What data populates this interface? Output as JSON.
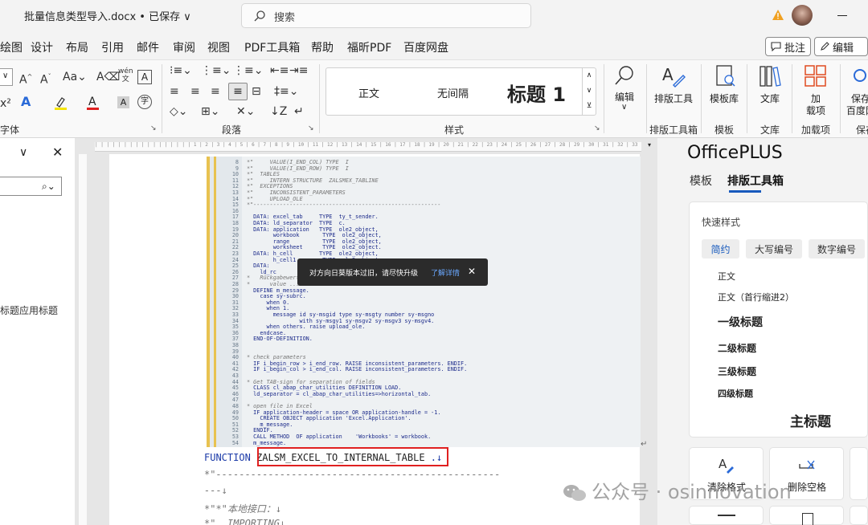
{
  "titlebar": {
    "doc_title": "批量信息类型导入.docx • 已保存 ∨",
    "search_placeholder": "搜索"
  },
  "menu": {
    "items": [
      "绘图",
      "设计",
      "布局",
      "引用",
      "邮件",
      "审阅",
      "视图",
      "PDF工具箱",
      "帮助",
      "福昕PDF",
      "百度网盘"
    ],
    "comment_btn": "批注",
    "edit_btn": "编辑"
  },
  "ribbon": {
    "group_font": "字体",
    "group_paragraph": "段落",
    "group_styles": "样式",
    "group_layout_tools": "排版工具箱",
    "group_template": "模板",
    "group_library": "文库",
    "group_addins": "加载项",
    "group_save": "保存",
    "styles": [
      "正文",
      "无间隔",
      "标题 1"
    ],
    "edit_label": "编辑",
    "layout_tool_label": "排版工具",
    "template_label": "模板库",
    "library_label": "文库",
    "addin_label_1": "加",
    "addin_label_2": "载项",
    "save_label_1": "保存",
    "save_label_2": "百度网"
  },
  "left_pane": {
    "heading_hint": "标题应用标题"
  },
  "toast": {
    "message": "对方向日葵版本过旧，请尽快升级",
    "link": "了解详情"
  },
  "document": {
    "func_keyword": "FUNCTION",
    "func_name": "ZALSM_EXCEL_TO_INTERNAL_TABLE",
    "func_tail": ".↓",
    "line2": "*\"-------------------------------------------------",
    "line3": "---↓",
    "line4": "*\"*\"本地接口：↓",
    "line5": "*\"  IMPORTING↓",
    "code_lines": [
      {
        "n": "8",
        "t": "*\"     VALUE(I_END_COL) TYPE  I"
      },
      {
        "n": "9",
        "t": "*\"     VALUE(I_END_ROW) TYPE  I"
      },
      {
        "n": "10",
        "t": "*\"  TABLES"
      },
      {
        "n": "11",
        "t": "*\"     INTERN STRUCTURE  ZALSMEX_TABLINE"
      },
      {
        "n": "12",
        "t": "*\"  EXCEPTIONS"
      },
      {
        "n": "13",
        "t": "*\"     INCONSISTENT_PARAMETERS"
      },
      {
        "n": "14",
        "t": "*\"     UPLOAD_OLE"
      },
      {
        "n": "15",
        "t": "*\"---------------------------------------------------------"
      },
      {
        "n": "16",
        "t": ""
      },
      {
        "n": "17",
        "t": "  DATA: excel_tab     TYPE  ty_t_sender."
      },
      {
        "n": "18",
        "t": "  DATA: ld_separator  TYPE  c."
      },
      {
        "n": "19",
        "t": "  DATA: application   TYPE  ole2_object,"
      },
      {
        "n": "20",
        "t": "        workbook       TYPE  ole2_object,"
      },
      {
        "n": "21",
        "t": "        range          TYPE  ole2_object,"
      },
      {
        "n": "22",
        "t": "        worksheet      TYPE  ole2_object."
      },
      {
        "n": "23",
        "t": "  DATA: h_cell        TYPE  ole2_object,"
      },
      {
        "n": "24",
        "t": "        h_cell1        TYPE  ole2_object."
      },
      {
        "n": "25",
        "t": "  DATA:"
      },
      {
        "n": "26",
        "t": "    ld_rc"
      },
      {
        "n": "27",
        "t": "*   Rückgabewert"
      },
      {
        "n": "28",
        "t": "*      value ..."
      },
      {
        "n": "29",
        "t": "  DEFINE m_message."
      },
      {
        "n": "30",
        "t": "    case sy-subrc."
      },
      {
        "n": "31",
        "t": "      when 0."
      },
      {
        "n": "32",
        "t": "      when 1."
      },
      {
        "n": "33",
        "t": "        message id sy-msgid type sy-msgty number sy-msgno"
      },
      {
        "n": "34",
        "t": "                with sy-msgv1 sy-msgv2 sy-msgv3 sy-msgv4."
      },
      {
        "n": "35",
        "t": "      when others. raise upload_ole."
      },
      {
        "n": "36",
        "t": "    endcase."
      },
      {
        "n": "37",
        "t": "  END-OF-DEFINITION."
      },
      {
        "n": "38",
        "t": ""
      },
      {
        "n": "39",
        "t": ""
      },
      {
        "n": "40",
        "t": "* check parameters"
      },
      {
        "n": "41",
        "t": "  IF i_begin_row > i_end_row. RAISE inconsistent_parameters. ENDIF."
      },
      {
        "n": "42",
        "t": "  IF i_begin_col > i_end_col. RAISE inconsistent_parameters. ENDIF."
      },
      {
        "n": "43",
        "t": ""
      },
      {
        "n": "44",
        "t": "* Get TAB-sign for separation of fields"
      },
      {
        "n": "45",
        "t": "  CLASS cl_abap_char_utilities DEFINITION LOAD."
      },
      {
        "n": "46",
        "t": "  ld_separator = cl_abap_char_utilities=>horizontal_tab."
      },
      {
        "n": "47",
        "t": ""
      },
      {
        "n": "48",
        "t": "* open file in Excel"
      },
      {
        "n": "49",
        "t": "  IF application-header = space OR application-handle = -1."
      },
      {
        "n": "50",
        "t": "    CREATE OBJECT application 'Excel.Application'."
      },
      {
        "n": "51",
        "t": "    m_message."
      },
      {
        "n": "52",
        "t": "  ENDIF."
      },
      {
        "n": "53",
        "t": "  CALL METHOD  OF application    'Workbooks' = workbook."
      },
      {
        "n": "54",
        "t": "  m_message."
      }
    ]
  },
  "right_pane": {
    "title": "OfficePLUS",
    "tab_template": "模板",
    "tab_layout": "排版工具箱",
    "quick_styles": "快速样式",
    "chips": [
      "简约",
      "大写编号",
      "数字编号"
    ],
    "style_items": [
      "正文",
      "正文（首行缩进2）",
      "一级标题",
      "二级标题",
      "三级标题",
      "四级标题",
      "主标题"
    ],
    "clear_format": "清除格式",
    "remove_spaces": "删除空格"
  },
  "watermark": "公众号 · osinnovation",
  "colors": {
    "accent": "#185abd",
    "highlight_box": "#e02020",
    "code_blue": "#1b2a8a"
  }
}
